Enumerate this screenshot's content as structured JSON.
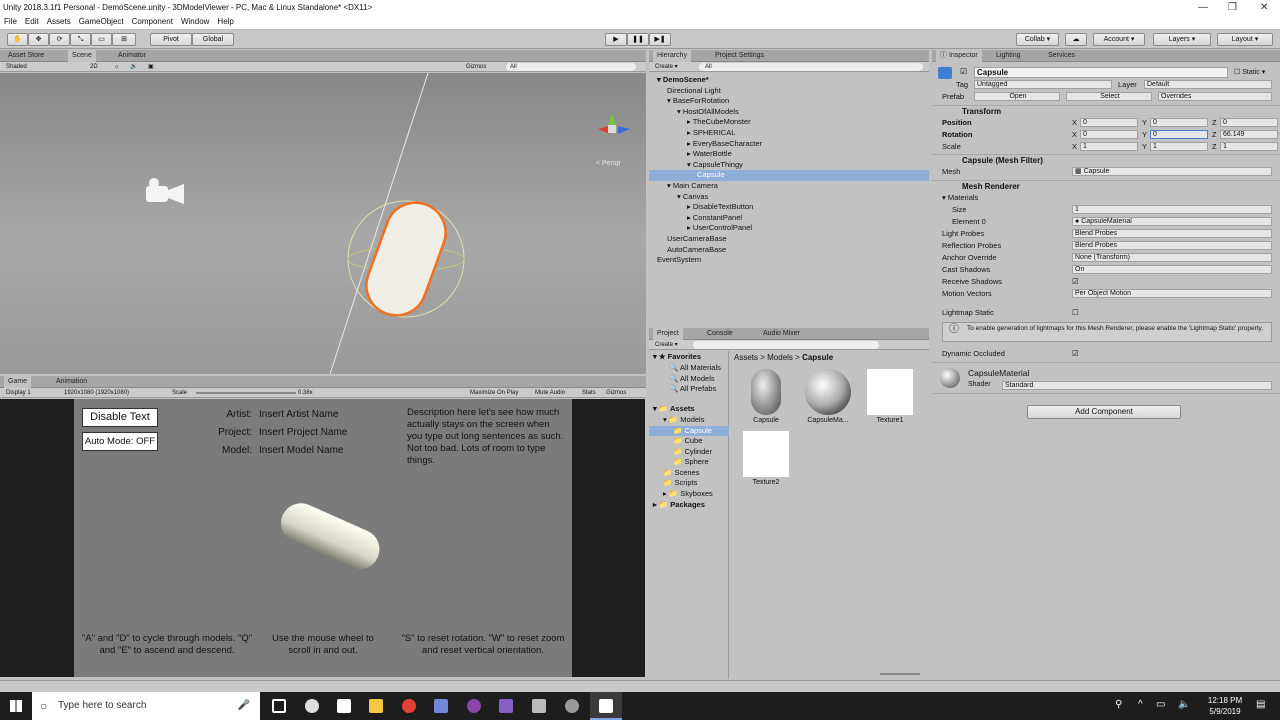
{
  "window": {
    "title": "Unity 2018.3.1f1 Personal - DemoScene.unity - 3DModelViewer - PC, Mac & Linux Standalone* <DX11>"
  },
  "menu": [
    "File",
    "Edit",
    "Assets",
    "GameObject",
    "Component",
    "Window",
    "Help"
  ],
  "toolbar": {
    "pivot": "Pivot",
    "global": "Global",
    "collab": "Collab ▾",
    "account": "Account",
    "layers": "Layers",
    "layout": "Layout"
  },
  "scene": {
    "tabs": [
      "Asset Store",
      "Scene",
      "Animator"
    ],
    "shading": "Shaded",
    "mode2d": "2D",
    "gizmos": "Gizmos",
    "search": "All",
    "persp": "< Persp"
  },
  "game": {
    "tabs": [
      "Game",
      "Animation"
    ],
    "display": "Display 1",
    "resolution": "1920x1080 (1920x1080)",
    "scale_label": "Scale",
    "scale_value": "0.38x",
    "maximize": "Maximize On Play",
    "mute": "Mute Audio",
    "stats": "Stats",
    "gizmos": "Gizmos",
    "disable_text": "Disable Text",
    "auto_mode": "Auto Mode: OFF",
    "artist_label": "Artist:",
    "artist_value": "Insert Artist Name",
    "project_label": "Project:",
    "project_value": "Insert Project Name",
    "model_label": "Model:",
    "model_value": "Insert Model Name",
    "description": "Description here let's see how much actually stays on the screen when you type out long sentences as such. Not too bad. Lots of room to type things.",
    "help1": "\"A\" and \"D\" to cycle through models. \"Q\" and \"E\" to ascend and descend.",
    "help2": "Use the mouse wheel to scroll in and out.",
    "help3": "\"S\" to reset rotation. \"W\" to reset zoom and reset vertical orientation."
  },
  "hierarchy": {
    "tabs": [
      "Hierarchy",
      "Project Settings"
    ],
    "create": "Create ▾",
    "search": "All",
    "rows": [
      {
        "label": "DemoScene*",
        "indent": 0
      },
      {
        "label": "Directional Light",
        "indent": 1
      },
      {
        "label": "BaseForRotation",
        "indent": 1
      },
      {
        "label": "HostOfAllModels",
        "indent": 2
      },
      {
        "label": "TheCubeMonster",
        "indent": 3
      },
      {
        "label": "SPHERICAL",
        "indent": 3
      },
      {
        "label": "EveryBaseCharacter",
        "indent": 3
      },
      {
        "label": "WaterBottle",
        "indent": 3
      },
      {
        "label": "CapsuleThingy",
        "indent": 3
      },
      {
        "label": "Capsule",
        "indent": 4
      },
      {
        "label": "Main Camera",
        "indent": 1
      },
      {
        "label": "Canvas",
        "indent": 2
      },
      {
        "label": "DisableTextButton",
        "indent": 3
      },
      {
        "label": "ConstantPanel",
        "indent": 3
      },
      {
        "label": "UserControlPanel",
        "indent": 3
      },
      {
        "label": "UserCameraBase",
        "indent": 1
      },
      {
        "label": "AutoCameraBase",
        "indent": 1
      },
      {
        "label": "EventSystem",
        "indent": 0
      }
    ]
  },
  "project": {
    "tabs": [
      "Project",
      "Console",
      "Audio Mixer"
    ],
    "create": "Create ▾",
    "favorites": "Favorites",
    "fav_items": [
      "All Materials",
      "All Models",
      "All Prefabs"
    ],
    "assets": "Assets",
    "tree": [
      "Models",
      "Capsule",
      "Cube",
      "Cylinder",
      "Sphere",
      "Scenes",
      "Scripts",
      "Skyboxes"
    ],
    "packages": "Packages",
    "breadcrumb": [
      "Assets",
      "Models",
      "Capsule"
    ],
    "files": [
      "Capsule",
      "CapsuleMa...",
      "Texture1",
      "Texture2"
    ]
  },
  "inspector": {
    "tabs": [
      "Inspector",
      "Lighting",
      "Services"
    ],
    "name": "Capsule",
    "static": "Static",
    "tag_label": "Tag",
    "tag": "Untagged",
    "layer_label": "Layer",
    "layer": "Default",
    "prefab_label": "Prefab",
    "open": "Open",
    "select": "Select",
    "overrides": "Overrides",
    "transform": "Transform",
    "position_label": "Position",
    "position": [
      "0",
      "0",
      "0"
    ],
    "rotation_label": "Rotation",
    "rotation": [
      "0",
      "0",
      "66.149"
    ],
    "scale_label": "Scale",
    "scale": [
      "1",
      "1",
      "1"
    ],
    "mesh_filter": "Capsule (Mesh Filter)",
    "mesh_label": "Mesh",
    "mesh": "Capsule",
    "mesh_renderer": "Mesh Renderer",
    "materials": "Materials",
    "size_label": "Size",
    "size": "1",
    "element_label": "Element 0",
    "element": "CapsuleMaterial",
    "light_probes_label": "Light Probes",
    "light_probes": "Blend Probes",
    "reflection_label": "Reflection Probes",
    "reflection": "Blend Probes",
    "anchor_label": "Anchor Override",
    "anchor": "None (Transform)",
    "cast_label": "Cast Shadows",
    "cast": "On",
    "receive_label": "Receive Shadows",
    "motion_label": "Motion Vectors",
    "motion": "Per Object Motion",
    "lightmap_label": "Lightmap Static",
    "info": "To enable generation of lightmaps for this Mesh Renderer, please enable the 'Lightmap Static' property.",
    "occluded_label": "Dynamic Occluded",
    "material_name": "CapsuleMaterial",
    "shader_label": "Shader",
    "shader": "Standard",
    "add_component": "Add Component"
  },
  "taskbar": {
    "search": "Type here to search",
    "time": "12:18 PM",
    "date": "5/9/2019"
  }
}
